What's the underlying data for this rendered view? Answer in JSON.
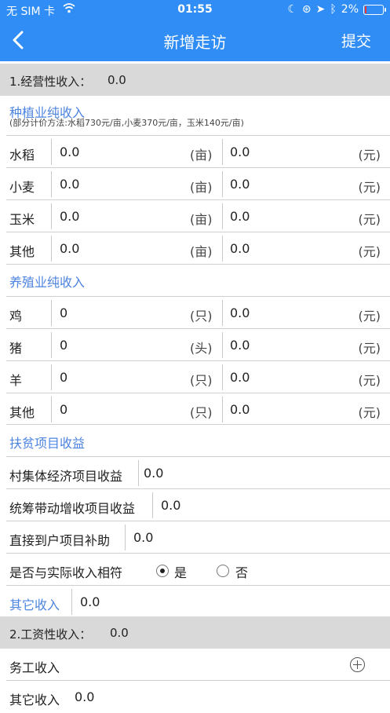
{
  "status": {
    "carrier": "无 SIM 卡",
    "time": "01:55",
    "battery": "2%"
  },
  "nav": {
    "title": "新增走访",
    "submit": "提交"
  },
  "section1": {
    "label": "1.经营性收入：",
    "value": "0.0"
  },
  "planting": {
    "title": "种植业纯收入",
    "note": "(部分计价方法:水稻730元/亩,小麦370元/亩，玉米140元/亩)",
    "rows": [
      {
        "label": "水稻",
        "v1": "0.0",
        "u1": "(亩)",
        "v2": "0.0",
        "u2": "(元)"
      },
      {
        "label": "小麦",
        "v1": "0.0",
        "u1": "(亩)",
        "v2": "0.0",
        "u2": "(元)"
      },
      {
        "label": "玉米",
        "v1": "0.0",
        "u1": "(亩)",
        "v2": "0.0",
        "u2": "(元)"
      },
      {
        "label": "其他",
        "v1": "0.0",
        "u1": "(亩)",
        "v2": "0.0",
        "u2": "(元)"
      }
    ]
  },
  "breeding": {
    "title": "养殖业纯收入",
    "rows": [
      {
        "label": "鸡",
        "v1": "0",
        "u1": "(只)",
        "v2": "0.0",
        "u2": "(元)"
      },
      {
        "label": "猪",
        "v1": "0",
        "u1": "(头)",
        "v2": "0.0",
        "u2": "(元)"
      },
      {
        "label": "羊",
        "v1": "0",
        "u1": "(只)",
        "v2": "0.0",
        "u2": "(元)"
      },
      {
        "label": "其他",
        "v1": "0",
        "u1": "(只)",
        "v2": "0.0",
        "u2": "(元)"
      }
    ]
  },
  "poverty": {
    "title": "扶贫项目收益",
    "village": {
      "label": "村集体经济项目收益",
      "value": "0.0"
    },
    "pooled": {
      "label": "统筹带动增收项目收益",
      "value": "0.0"
    },
    "direct": {
      "label": "直接到户项目补助",
      "value": "0.0"
    },
    "match": {
      "label": "是否与实际收入相符",
      "yes": "是",
      "no": "否",
      "selected": "yes"
    }
  },
  "other": {
    "label": "其它收入",
    "value": "0.0"
  },
  "section2": {
    "label": "2.工资性收入：",
    "value": "0.0"
  },
  "labor": {
    "label": "务工收入"
  },
  "other2": {
    "label": "其它收入",
    "value": "0.0"
  }
}
